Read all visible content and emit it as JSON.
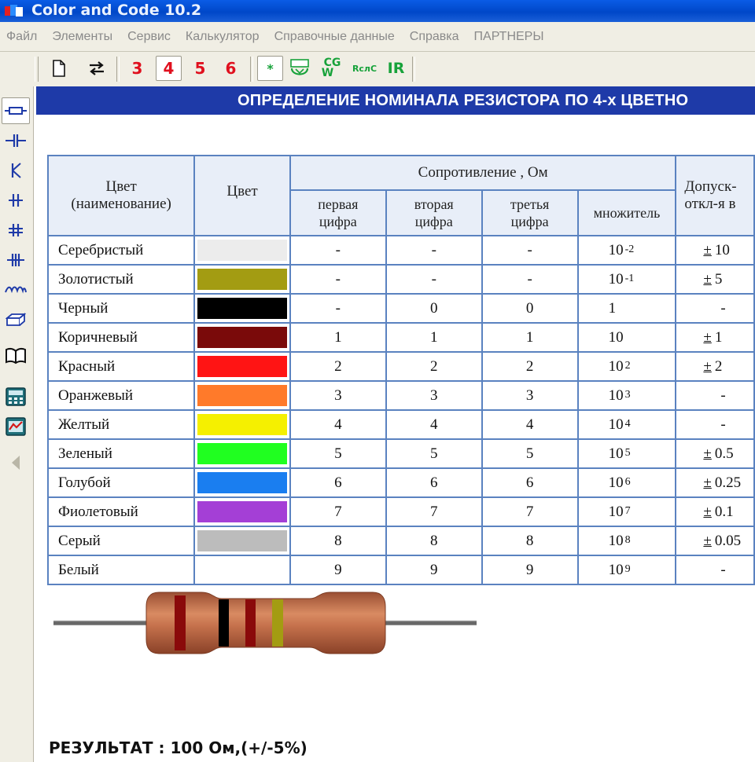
{
  "window": {
    "title": "Color and Code 10.2"
  },
  "menu": [
    "Файл",
    "Элементы",
    "Сервис",
    "Калькулятор",
    "Справочные данные",
    "Справка",
    "ПАРТНЕРЫ"
  ],
  "toolbar": {
    "digits": [
      "3",
      "4",
      "5",
      "6"
    ],
    "selected_digit": "4",
    "star_label": "*",
    "cgw_top": "CG",
    "cgw_bottom": "W",
    "rlc_label": "RслC",
    "ir_label": "IR"
  },
  "banner": {
    "text": "ОПРЕДЕЛЕНИЕ НОМИНАЛА РЕЗИСТОРА ПО 4-х ЦВЕТНО"
  },
  "table": {
    "headers": {
      "color_name_1": "Цвет",
      "color_name_2": "(наименование)",
      "color": "Цвет",
      "resistance": "Сопротивление , Ом",
      "first_1": "первая",
      "first_2": "цифра",
      "second_1": "вторая",
      "second_2": "цифра",
      "third_1": "третья",
      "third_2": "цифра",
      "multiplier": "множитель",
      "tolerance_1": "Допуск-",
      "tolerance_2": "откл-я в"
    },
    "rows": [
      {
        "name": "Серебристый",
        "swatch": "#ececec",
        "d1": "-",
        "d2": "-",
        "d3": "-",
        "mult_base": "10",
        "mult_exp": "-2",
        "tol_pm": "±",
        "tol": "10"
      },
      {
        "name": "Золотистый",
        "swatch": "#a39c12",
        "d1": "-",
        "d2": "-",
        "d3": "-",
        "mult_base": "10",
        "mult_exp": "-1",
        "tol_pm": "±",
        "tol": "5"
      },
      {
        "name": "Черный",
        "swatch": "#000000",
        "d1": "-",
        "d2": "0",
        "d3": "0",
        "mult_base": "1",
        "mult_exp": "",
        "tol_pm": "",
        "tol": "-"
      },
      {
        "name": "Коричневый",
        "swatch": "#7a0a0a",
        "d1": "1",
        "d2": "1",
        "d3": "1",
        "mult_base": "10",
        "mult_exp": "",
        "tol_pm": "±",
        "tol": "1"
      },
      {
        "name": "Красный",
        "swatch": "#ff1414",
        "d1": "2",
        "d2": "2",
        "d3": "2",
        "mult_base": "10",
        "mult_exp": "2",
        "tol_pm": "±",
        "tol": "2"
      },
      {
        "name": "Оранжевый",
        "swatch": "#ff7a2a",
        "d1": "3",
        "d2": "3",
        "d3": "3",
        "mult_base": "10",
        "mult_exp": "3",
        "tol_pm": "",
        "tol": "-"
      },
      {
        "name": "Желтый",
        "swatch": "#f5f000",
        "d1": "4",
        "d2": "4",
        "d3": "4",
        "mult_base": "10",
        "mult_exp": "4",
        "tol_pm": "",
        "tol": "-"
      },
      {
        "name": "Зеленый",
        "swatch": "#20ff20",
        "d1": "5",
        "d2": "5",
        "d3": "5",
        "mult_base": "10",
        "mult_exp": "5",
        "tol_pm": "±",
        "tol": "0.5"
      },
      {
        "name": "Голубой",
        "swatch": "#1a7ef0",
        "d1": "6",
        "d2": "6",
        "d3": "6",
        "mult_base": "10",
        "mult_exp": "6",
        "tol_pm": "±",
        "tol": "0.25"
      },
      {
        "name": "Фиолетовый",
        "swatch": "#a43fd6",
        "d1": "7",
        "d2": "7",
        "d3": "7",
        "mult_base": "10",
        "mult_exp": "7",
        "tol_pm": "±",
        "tol": "0.1"
      },
      {
        "name": "Серый",
        "swatch": "#bcbcbc",
        "d1": "8",
        "d2": "8",
        "d3": "8",
        "mult_base": "10",
        "mult_exp": "8",
        "tol_pm": "±",
        "tol": "0.05"
      },
      {
        "name": "Белый",
        "swatch": "#ffffff",
        "d1": "9",
        "d2": "9",
        "d3": "9",
        "mult_base": "10",
        "mult_exp": "9",
        "tol_pm": "",
        "tol": "-"
      }
    ]
  },
  "resistor": {
    "body_color": "#c5714c",
    "lead_color": "#6b6b6b",
    "bands": [
      {
        "name": "Коричневый",
        "color": "#8a0a0a"
      },
      {
        "name": "Черный",
        "color": "#000000"
      },
      {
        "name": "Коричневый",
        "color": "#8a0a0a"
      },
      {
        "name": "Золотистый",
        "color": "#a39c12"
      }
    ]
  },
  "result": {
    "text": "РЕЗУЛЬТАТ : 100 Ом,(+/-5%)"
  }
}
